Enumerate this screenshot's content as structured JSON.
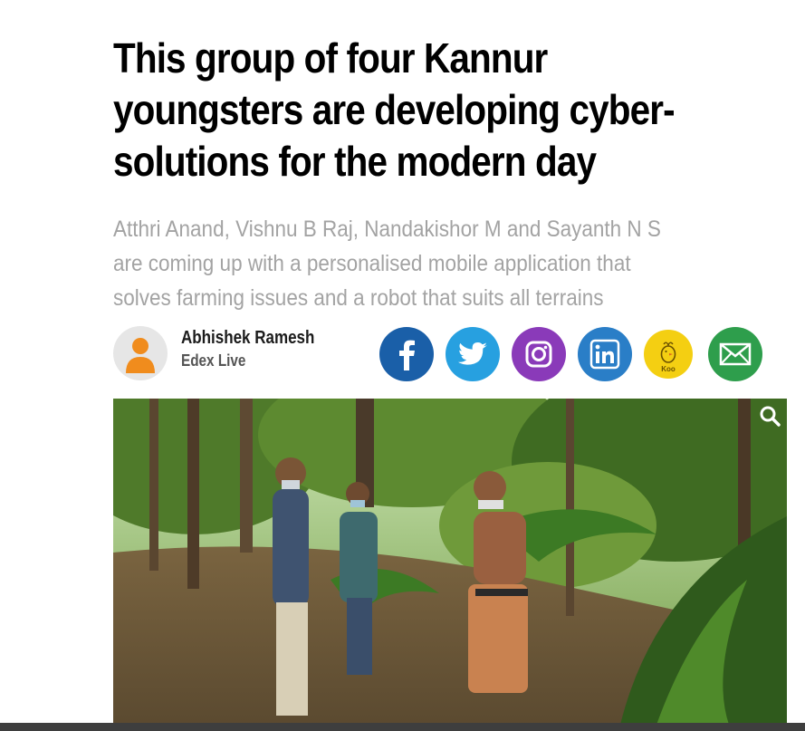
{
  "article": {
    "headline": "This group of four Kannur youngsters are developing cyber-solutions for the modern day",
    "subheadline": "Atthri Anand, Vishnu B Raj, Nandakishor M and Sayanth N S are coming up with a personalised mobile application that solves farming issues and a robot that suits all terrains"
  },
  "author": {
    "name": "Abhishek Ramesh",
    "organization": "Edex Live",
    "avatar_icon": "person-silhouette-icon"
  },
  "share": {
    "buttons": [
      {
        "network": "facebook",
        "icon": "facebook-icon",
        "color": "#1a5fa8"
      },
      {
        "network": "twitter",
        "icon": "twitter-icon",
        "color": "#27a0e0"
      },
      {
        "network": "instagram",
        "icon": "instagram-icon",
        "color": "#8a3ab9"
      },
      {
        "network": "linkedin",
        "icon": "linkedin-icon",
        "color": "#2a7ec7"
      },
      {
        "network": "koo",
        "icon": "koo-icon",
        "color": "#f4cf12",
        "label": "Koo"
      },
      {
        "network": "email",
        "icon": "envelope-icon",
        "color": "#2e9e4c"
      }
    ]
  },
  "image": {
    "zoom_icon": "magnifier-icon"
  }
}
